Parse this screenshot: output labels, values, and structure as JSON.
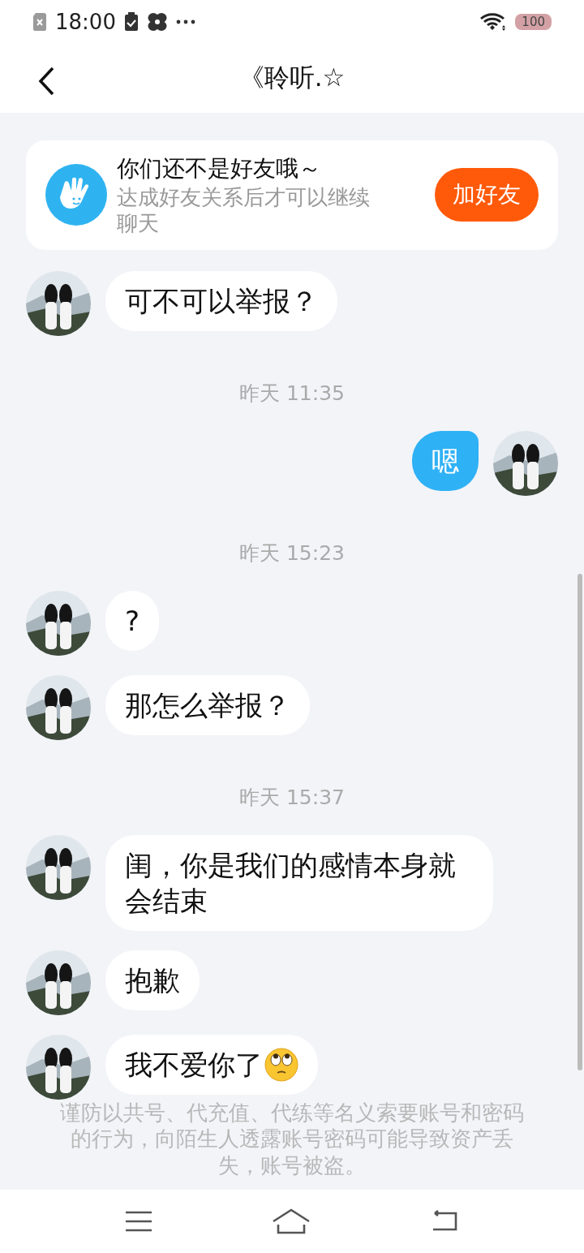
{
  "status_bar": {
    "time": "18:00",
    "battery": "100"
  },
  "header": {
    "title": "《聆听.☆"
  },
  "friend_banner": {
    "title": "你们还不是好友哦～",
    "subtitle": "达成好友关系后才可以继续聊天",
    "button": "加好友"
  },
  "messages": [
    {
      "kind": "incoming",
      "text": "可不可以举报？"
    },
    {
      "kind": "time",
      "text": "昨天 11:35"
    },
    {
      "kind": "outgoing",
      "text": "嗯"
    },
    {
      "kind": "time",
      "text": "昨天 15:23"
    },
    {
      "kind": "incoming",
      "text": "?"
    },
    {
      "kind": "incoming",
      "text": "那怎么举报？"
    },
    {
      "kind": "time",
      "text": "昨天 15:37"
    },
    {
      "kind": "incoming",
      "text": "闺，你是我们的感情本身就会结束"
    },
    {
      "kind": "incoming",
      "text": "抱歉"
    },
    {
      "kind": "incoming",
      "text": "我不爱你了",
      "emoji": true
    }
  ],
  "notice": "谨防以共号、代充值、代练等名义索要账号和密码的行为，向陌生人透露账号密码可能导致资产丢失，账号被盗。"
}
